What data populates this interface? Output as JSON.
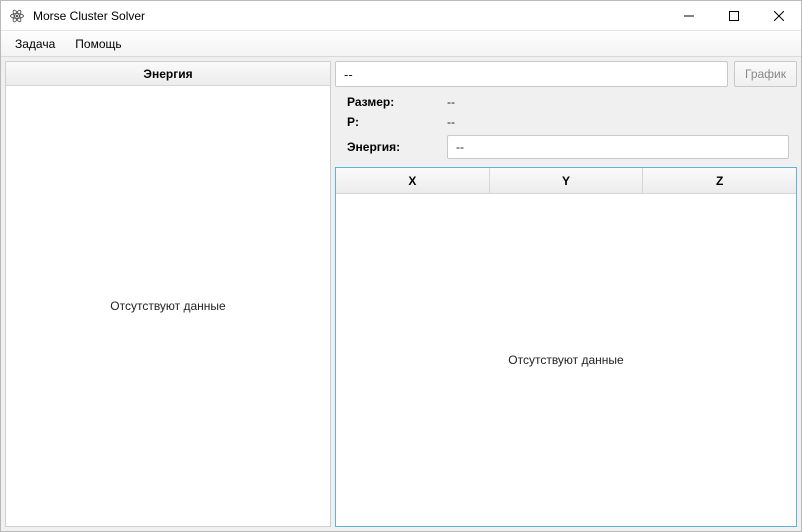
{
  "window": {
    "title": "Morse Cluster Solver"
  },
  "menu": {
    "task": "Задача",
    "help": "Помощь"
  },
  "left": {
    "header": "Энергия",
    "empty": "Отсутствуют данные"
  },
  "right": {
    "top_input_value": "--",
    "graph_button": "График",
    "info": {
      "size_label": "Размер:",
      "size_value": "--",
      "p_label": "P:",
      "p_value": "--",
      "energy_label": "Энергия:",
      "energy_value": "--"
    },
    "table": {
      "col_x": "X",
      "col_y": "Y",
      "col_z": "Z",
      "empty": "Отсутствуют данные"
    }
  }
}
